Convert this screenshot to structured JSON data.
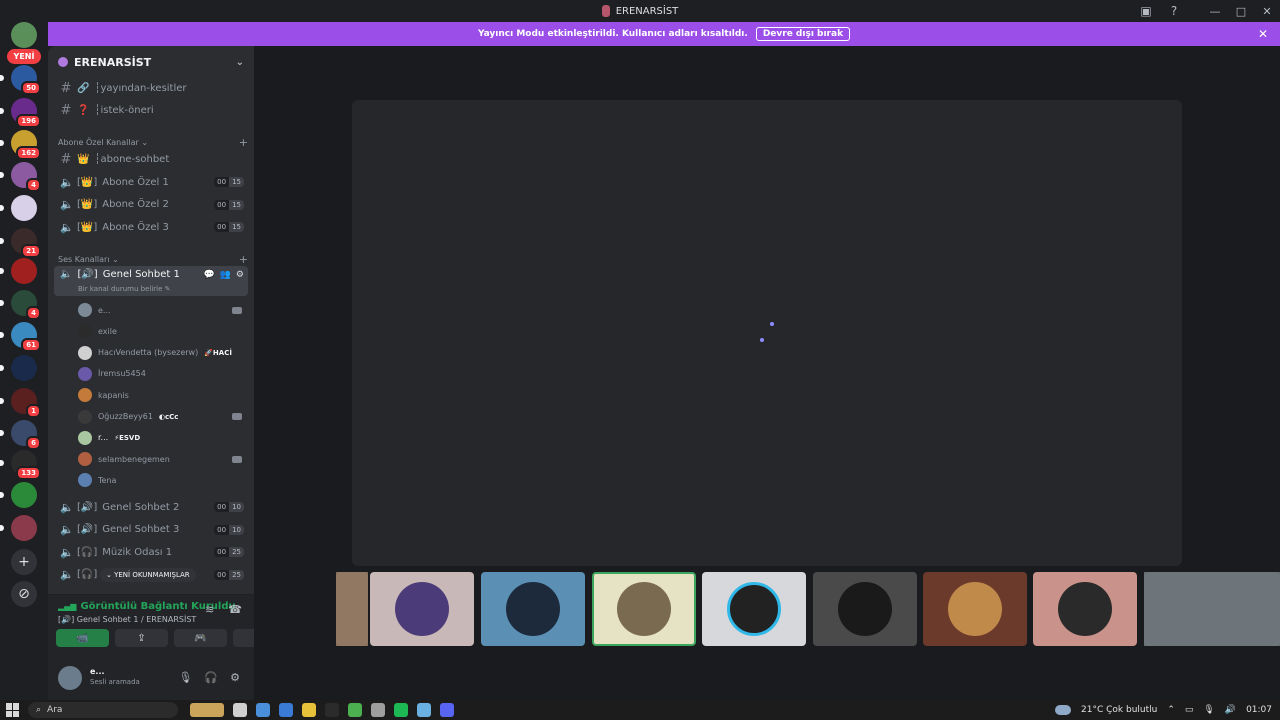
{
  "window": {
    "title": "ERENARSİST",
    "min": "—",
    "max": "□",
    "close": "✕"
  },
  "guilds": {
    "new_label": "YENİ",
    "badges": [
      "50",
      "196",
      "162",
      "4",
      "21",
      "4",
      "61",
      "1",
      "6",
      "133"
    ],
    "add_icon": "+",
    "explore_icon": "⊘"
  },
  "notice": {
    "text": "Yayıncı Modu etkinleştirildi. Kullanıcı adları kısaltıldı.",
    "button": "Devre dışı bırak",
    "close": "✕"
  },
  "server": {
    "name": "ERENARSİST",
    "chevron": "⌄"
  },
  "channels": {
    "top": [
      {
        "prefix": "🔗",
        "name": "┆yayından-kesitler"
      },
      {
        "prefix": "❓",
        "name": "┆istek-öneri"
      }
    ],
    "category_sub": "Abone Özel Kanallar ⌄",
    "sub_text_channel": {
      "prefix": "👑",
      "name": "┆abone-sohbet"
    },
    "sub_voice": [
      {
        "name": "Abone Özel 1",
        "c1": "00",
        "c2": "15"
      },
      {
        "name": "Abone Özel 2",
        "c1": "00",
        "c2": "15"
      },
      {
        "name": "Abone Özel 3",
        "c1": "00",
        "c2": "15"
      }
    ],
    "sub_voice_prefix": "[👑]",
    "category_voice": "Ses Kanalları ⌄",
    "plus": "+",
    "active": {
      "prefix": "[🔊]",
      "name": "Genel Sohbet 1",
      "status": "Bir kanal durumu belirle ✎"
    },
    "members": [
      {
        "name": "e...",
        "tag": "",
        "cam": true,
        "color": "#7b8a96"
      },
      {
        "name": "exile",
        "tag": "",
        "cam": false,
        "color": "#2b2b2b"
      },
      {
        "name": "HacıVendetta (bysezerw)",
        "tag": "🚀HACİ",
        "cam": false,
        "color": "#d0d0d0"
      },
      {
        "name": "İremsu5454",
        "tag": "",
        "cam": false,
        "color": "#6a58a8"
      },
      {
        "name": "kapanis",
        "tag": "",
        "cam": false,
        "color": "#c47a3a"
      },
      {
        "name": "OğuzzBeyy61",
        "tag": "◐cCc",
        "cam": true,
        "color": "#3a3a3a"
      },
      {
        "name": "r...",
        "tag": "⚡ESVD",
        "cam": false,
        "color": "#a9c7a0"
      },
      {
        "name": "selambenegemen",
        "tag": "",
        "cam": true,
        "color": "#b06040"
      },
      {
        "name": "Tena",
        "tag": "",
        "cam": false,
        "color": "#5a7fb0"
      }
    ],
    "voice_after": [
      {
        "prefix": "[🔊]",
        "name": "Genel Sohbet 2",
        "c1": "00",
        "c2": "10"
      },
      {
        "prefix": "[🔊]",
        "name": "Genel Sohbet 3",
        "c1": "00",
        "c2": "10"
      },
      {
        "prefix": "[🎧]",
        "name": "Müzik Odası 1",
        "c1": "00",
        "c2": "25"
      },
      {
        "prefix": "[🎧]",
        "name": "",
        "c1": "00",
        "c2": "25"
      }
    ],
    "unread_pill": "⌄ YENİ OKUNMAMIŞLAR"
  },
  "voice": {
    "connected": "Görüntülü Bağlantı Kuruldu",
    "channel": "[🔊] Genel Sohbet 1 / ERENARSİST",
    "wave_icon": "≋",
    "hangup_icon": "☎",
    "buttons": [
      "📹",
      "⇪",
      "🎮",
      "🚀"
    ]
  },
  "user": {
    "name": "e...",
    "status": "Sesli aramada",
    "mic": "🎙",
    "headset": "🎧",
    "settings": "⚙"
  },
  "tiles": [
    {
      "bg": "#3a3d42",
      "color": "#c9a07a",
      "type": "video"
    },
    {
      "bg": "#c9b8b8",
      "color": "#4b3b78",
      "type": "avatar"
    },
    {
      "bg": "#5b8fb3",
      "color": "#1d2a3c",
      "type": "avatar"
    },
    {
      "bg": "#e6e2c4",
      "color": "#7a6a50",
      "type": "avatar",
      "selected": true
    },
    {
      "bg": "#d6d8dc",
      "color": "#222222",
      "type": "avatar",
      "ring": true
    },
    {
      "bg": "#4a4a4a",
      "color": "#1a1a1a",
      "type": "avatar"
    },
    {
      "bg": "#6b3a2a",
      "color": "#c08a4a",
      "type": "avatar"
    },
    {
      "bg": "#c9928a",
      "color": "#2a2a2a",
      "type": "avatar"
    },
    {
      "bg": "#2c3236",
      "color": "#9aa0a8",
      "type": "video"
    }
  ],
  "taskbar": {
    "search": "Ara",
    "weather": "21°C  Çok bulutlu",
    "time": "01:07",
    "app_colors": [
      "#c9a45a",
      "#cfcfcf",
      "#4a8fd9",
      "#3a7bd5",
      "#e8c13a",
      "#2b2b2b",
      "#4caf50",
      "#9e9e9e",
      "#1db954",
      "#6ab0e0",
      "#5865f2"
    ]
  }
}
